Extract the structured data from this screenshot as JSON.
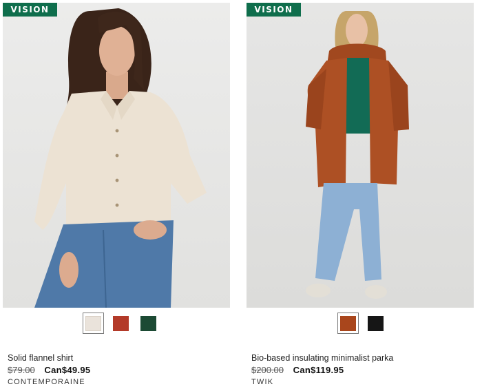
{
  "products": [
    {
      "badge": "VISION",
      "image_icon": "flannel-shirt-model-photo",
      "swatches": [
        {
          "color": "#eae3db",
          "selected": true
        },
        {
          "color": "#b33a29",
          "selected": false
        },
        {
          "color": "#1c4a34",
          "selected": false
        }
      ],
      "name": "Solid flannel shirt",
      "old_price": "$79.00",
      "price": "Can$49.95",
      "brand": "CONTEMPORAINE"
    },
    {
      "badge": "VISION",
      "image_icon": "insulating-parka-model-photo",
      "swatches": [
        {
          "color": "#a9461c",
          "selected": true
        },
        {
          "color": "#161616",
          "selected": false
        }
      ],
      "name": "Bio-based insulating minimalist parka",
      "old_price": "$200.00",
      "price": "Can$119.95",
      "brand": "TWIK"
    }
  ],
  "colors": {
    "badge_bg": "#0f6e4c",
    "selected_border": "#7a7a7a"
  }
}
